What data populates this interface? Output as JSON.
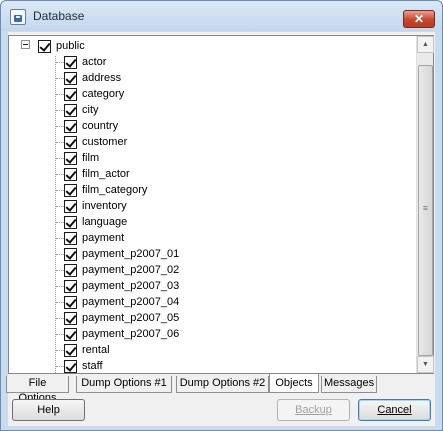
{
  "window": {
    "title": "Database",
    "close_glyph": "✕"
  },
  "tree": {
    "root": {
      "label": "public",
      "checked": true,
      "expanded": true
    },
    "children": [
      {
        "label": "actor",
        "checked": true
      },
      {
        "label": "address",
        "checked": true
      },
      {
        "label": "category",
        "checked": true
      },
      {
        "label": "city",
        "checked": true
      },
      {
        "label": "country",
        "checked": true
      },
      {
        "label": "customer",
        "checked": true
      },
      {
        "label": "film",
        "checked": true
      },
      {
        "label": "film_actor",
        "checked": true
      },
      {
        "label": "film_category",
        "checked": true
      },
      {
        "label": "inventory",
        "checked": true
      },
      {
        "label": "language",
        "checked": true
      },
      {
        "label": "payment",
        "checked": true
      },
      {
        "label": "payment_p2007_01",
        "checked": true
      },
      {
        "label": "payment_p2007_02",
        "checked": true
      },
      {
        "label": "payment_p2007_03",
        "checked": true
      },
      {
        "label": "payment_p2007_04",
        "checked": true
      },
      {
        "label": "payment_p2007_05",
        "checked": true
      },
      {
        "label": "payment_p2007_06",
        "checked": true
      },
      {
        "label": "rental",
        "checked": true
      },
      {
        "label": "staff",
        "checked": true
      }
    ]
  },
  "tabs": [
    {
      "label": "File Options",
      "active": false
    },
    {
      "label": "Dump Options #1",
      "active": false
    },
    {
      "label": "Dump Options #2",
      "active": false
    },
    {
      "label": "Objects",
      "active": true
    },
    {
      "label": "Messages",
      "active": false
    }
  ],
  "buttons": {
    "help": "Help",
    "backup": "Backup",
    "cancel": "Cancel"
  }
}
